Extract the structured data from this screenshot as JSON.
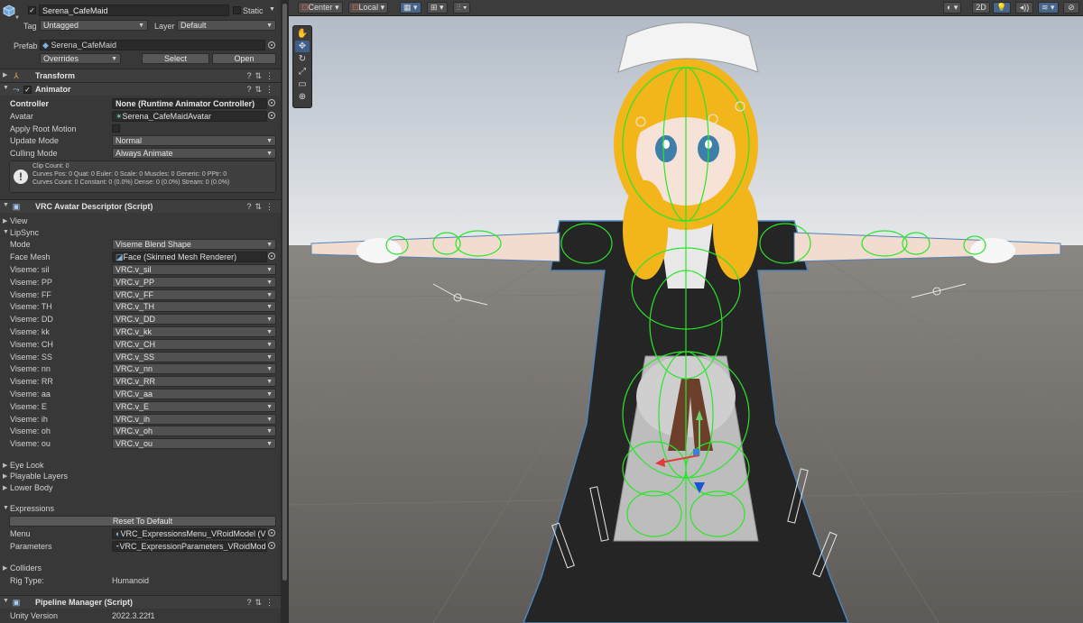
{
  "header": {
    "object_name": "Serena_CafeMaid",
    "static_label": "Static",
    "tag_label": "Tag",
    "tag_value": "Untagged",
    "layer_label": "Layer",
    "layer_value": "Default",
    "prefab_label": "Prefab",
    "prefab_value": "Serena_CafeMaid",
    "overrides_label": "Overrides",
    "select_label": "Select",
    "open_label": "Open"
  },
  "transform": {
    "title": "Transform"
  },
  "animator": {
    "title": "Animator",
    "controller_label": "Controller",
    "controller_value": "None (Runtime Animator Controller)",
    "avatar_label": "Avatar",
    "avatar_value": "Serena_CafeMaidAvatar",
    "apply_root_motion_label": "Apply Root Motion",
    "update_mode_label": "Update Mode",
    "update_mode_value": "Normal",
    "culling_mode_label": "Culling Mode",
    "culling_mode_value": "Always Animate",
    "info_line1": "Clip Count: 0",
    "info_line2": "Curves Pos: 0 Quat: 0 Euler: 0 Scale: 0 Muscles: 0 Generic: 0 PPtr: 0",
    "info_line3": "Curves Count: 0 Constant: 0 (0.0%) Dense: 0 (0.0%) Stream: 0 (0.0%)"
  },
  "descriptor": {
    "title": "VRC Avatar Descriptor (Script)",
    "view_label": "View",
    "lipsync_label": "LipSync",
    "mode_label": "Mode",
    "mode_value": "Viseme Blend Shape",
    "face_mesh_label": "Face Mesh",
    "face_mesh_value": "Face (Skinned Mesh Renderer)",
    "visemes": [
      {
        "label": "Viseme: sil",
        "value": "VRC.v_sil"
      },
      {
        "label": "Viseme: PP",
        "value": "VRC.v_PP"
      },
      {
        "label": "Viseme: FF",
        "value": "VRC.v_FF"
      },
      {
        "label": "Viseme: TH",
        "value": "VRC.v_TH"
      },
      {
        "label": "Viseme: DD",
        "value": "VRC.v_DD"
      },
      {
        "label": "Viseme: kk",
        "value": "VRC.v_kk"
      },
      {
        "label": "Viseme: CH",
        "value": "VRC.v_CH"
      },
      {
        "label": "Viseme: SS",
        "value": "VRC.v_SS"
      },
      {
        "label": "Viseme: nn",
        "value": "VRC.v_nn"
      },
      {
        "label": "Viseme: RR",
        "value": "VRC.v_RR"
      },
      {
        "label": "Viseme: aa",
        "value": "VRC.v_aa"
      },
      {
        "label": "Viseme: E",
        "value": "VRC.v_E"
      },
      {
        "label": "Viseme: ih",
        "value": "VRC.v_ih"
      },
      {
        "label": "Viseme: oh",
        "value": "VRC.v_oh"
      },
      {
        "label": "Viseme: ou",
        "value": "VRC.v_ou"
      }
    ],
    "eye_look_label": "Eye Look",
    "playable_layers_label": "Playable Layers",
    "lower_body_label": "Lower Body",
    "expressions_label": "Expressions",
    "reset_label": "Reset To Default",
    "menu_label": "Menu",
    "menu_value": "VRC_ExpressionsMenu_VRoidModel (VRC",
    "parameters_label": "Parameters",
    "parameters_value": "VRC_ExpressionParameters_VRoidModel",
    "colliders_label": "Colliders",
    "rig_type_label": "Rig Type:",
    "rig_type_value": "Humanoid"
  },
  "pipeline": {
    "title": "Pipeline Manager (Script)",
    "unity_version_label": "Unity Version",
    "unity_version_value": "2022.3.22f1"
  },
  "scene_toolbar": {
    "pivot_label": "Center",
    "space_label": "Local",
    "mode_2d_label": "2D"
  },
  "colors": {
    "sky_top": "#b9c3cf",
    "ground": "#6e6a66",
    "collider_green": "#28e628",
    "hair": "#f2b51a"
  }
}
